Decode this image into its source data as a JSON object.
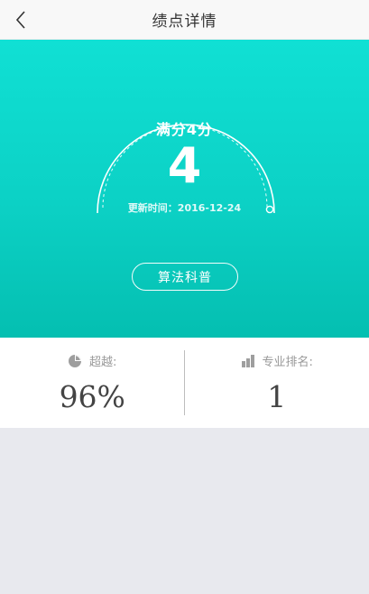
{
  "navbar": {
    "title": "绩点详情",
    "back_icon": "chevron-left-icon"
  },
  "hero": {
    "full_score_label": "满分4分",
    "score": "4",
    "update_time": "更新时间：2016-12-24",
    "algo_button_label": "算法科普",
    "gauge_progress": 1.0
  },
  "stats": {
    "surpass": {
      "label": "超越:",
      "value": "96%",
      "icon": "pie-chart-icon"
    },
    "rank": {
      "label": "专业排名:",
      "value": "1",
      "icon": "bar-chart-icon"
    }
  },
  "colors": {
    "hero_top": "#10e0d4",
    "hero_bottom": "#04bfb1",
    "icon_gray": "#9e9e9e",
    "page_bg": "#e8e9ee"
  }
}
